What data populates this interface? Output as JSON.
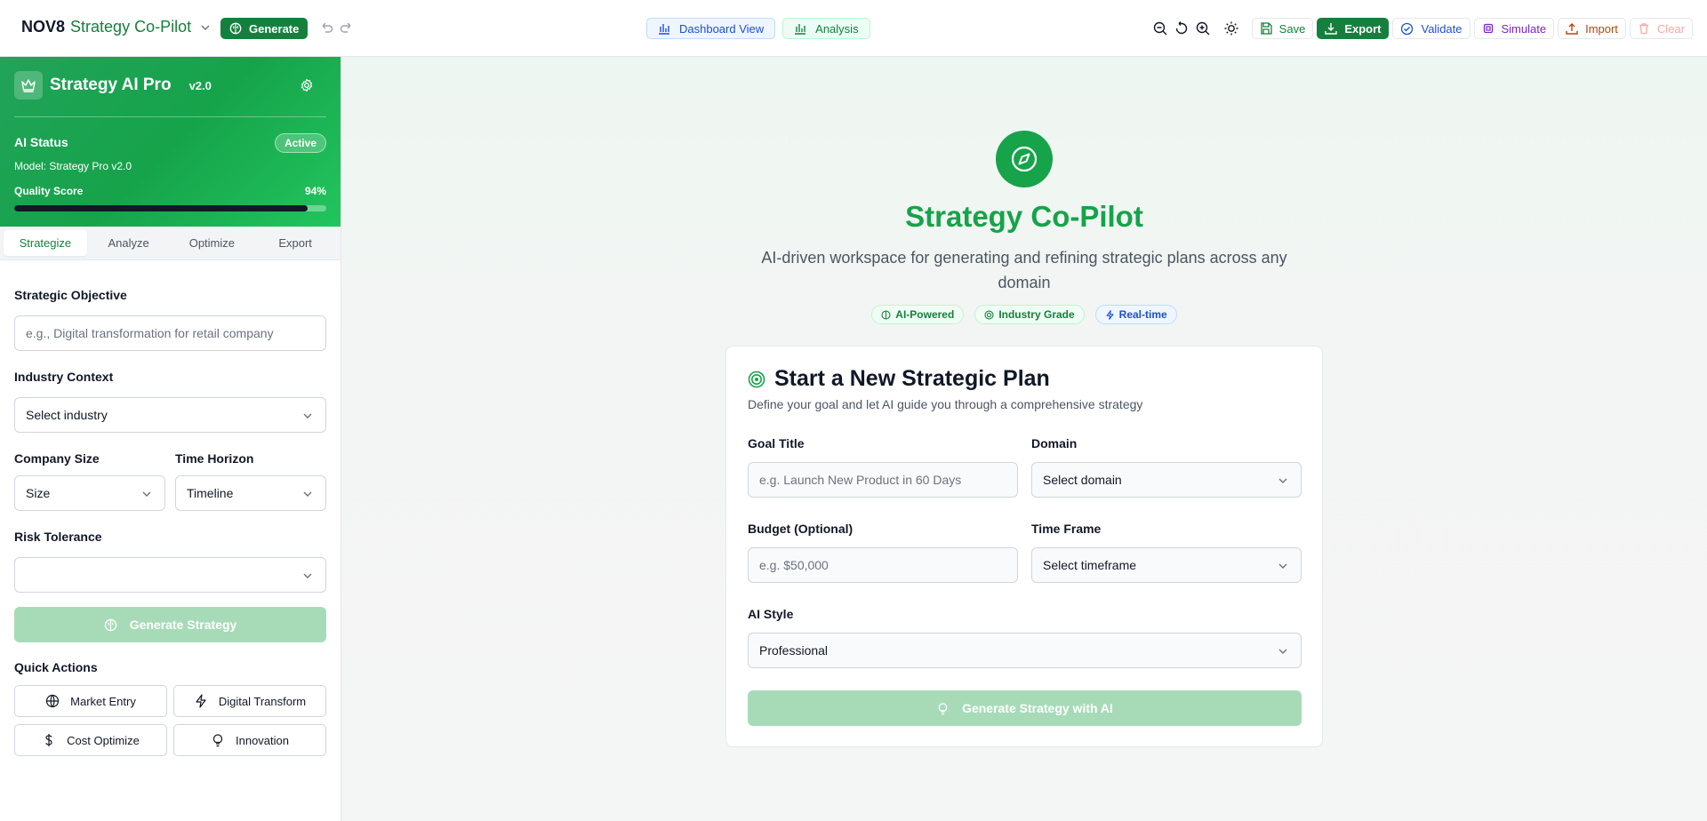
{
  "header": {
    "brand_bold": "NOV8",
    "brand_rest": "Strategy Co-Pilot",
    "generate_label": "Generate",
    "tabs": [
      {
        "label": "Dashboard View"
      },
      {
        "label": "Analysis"
      }
    ],
    "actions": {
      "save": "Save",
      "export": "Export",
      "validate": "Validate",
      "simulate": "Simulate",
      "import": "Import",
      "clear": "Clear"
    }
  },
  "sidebar": {
    "title": "Strategy AI Pro",
    "version": "v2.0",
    "ai_status_label": "AI Status",
    "ai_status_badge": "Active",
    "model": "Model: Strategy Pro v2.0",
    "quality_label": "Quality Score",
    "quality_value": "94%",
    "quality_fraction": 0.94,
    "tabs": [
      "Strategize",
      "Analyze",
      "Optimize",
      "Export"
    ],
    "active_tab": "Strategize",
    "form": {
      "objective_label": "Strategic Objective",
      "objective_placeholder": "e.g., Digital transformation for retail company",
      "industry_label": "Industry Context",
      "industry_value": "Select industry",
      "size_label": "Company Size",
      "size_value": "Size",
      "horizon_label": "Time Horizon",
      "horizon_value": "Timeline",
      "risk_label": "Risk Tolerance",
      "risk_value": ""
    },
    "generate_strategy": "Generate Strategy",
    "quick_actions_title": "Quick Actions",
    "quick_actions": [
      {
        "label": "Market Entry",
        "icon": "globe-icon"
      },
      {
        "label": "Digital Transform",
        "icon": "lightning-icon"
      },
      {
        "label": "Cost Optimize",
        "icon": "dollar-icon"
      },
      {
        "label": "Innovation",
        "icon": "lightbulb-icon"
      }
    ]
  },
  "main": {
    "title": "Strategy Co-Pilot",
    "subtitle": "AI-driven workspace for generating and refining strategic plans across any domain",
    "badges": [
      "AI-Powered",
      "Industry Grade",
      "Real-time"
    ],
    "card": {
      "title": "Start a New Strategic Plan",
      "subtitle": "Define your goal and let AI guide you through a comprehensive strategy",
      "goal_label": "Goal Title",
      "goal_placeholder": "e.g. Launch New Product in 60 Days",
      "domain_label": "Domain",
      "domain_value": "Select domain",
      "budget_label": "Budget (Optional)",
      "budget_placeholder": "e.g. $50,000",
      "timeframe_label": "Time Frame",
      "timeframe_value": "Select timeframe",
      "style_label": "AI Style",
      "style_value": "Professional",
      "generate_label": "Generate Strategy with AI"
    }
  },
  "colors": {
    "brand_green": "#16a34a",
    "dark_green": "#15803d",
    "disabled_green": "#a7dbb8"
  }
}
